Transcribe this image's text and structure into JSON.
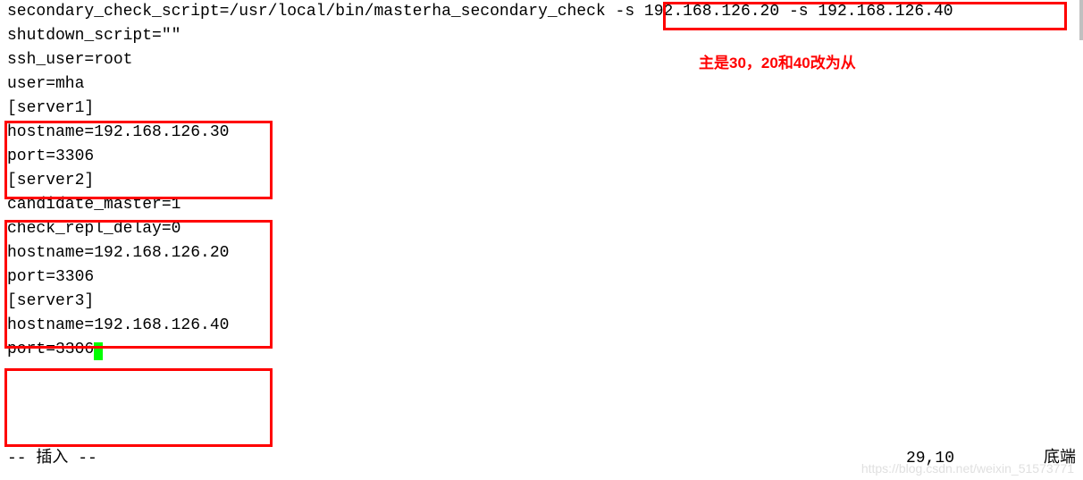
{
  "config": {
    "line1_prefix": "secondary_check_script=/usr/local/bin/masterha_secondary_check",
    "line1_args": " -s 192.168.126.20 -s 192.168.126.40",
    "line2": "shutdown_script=\"\"",
    "line3": "ssh_user=root",
    "line4": "user=mha",
    "blank": "",
    "server1": {
      "header": "[server1]",
      "hostname": "hostname=192.168.126.30",
      "port": "port=3306"
    },
    "server2": {
      "header": "[server2]",
      "candidate": "candidate_master=1",
      "check_repl": "check_repl_delay=0",
      "hostname": "hostname=192.168.126.20",
      "port": "port=3306"
    },
    "server3": {
      "header": "[server3]",
      "hostname": "hostname=192.168.126.40",
      "port": "port=3306"
    }
  },
  "annotation": "主是30，20和40改为从",
  "status": {
    "mode": "-- 插入 --",
    "position": "29,10",
    "location": "底端"
  },
  "watermark": "https://blog.csdn.net/weixin_51573771"
}
